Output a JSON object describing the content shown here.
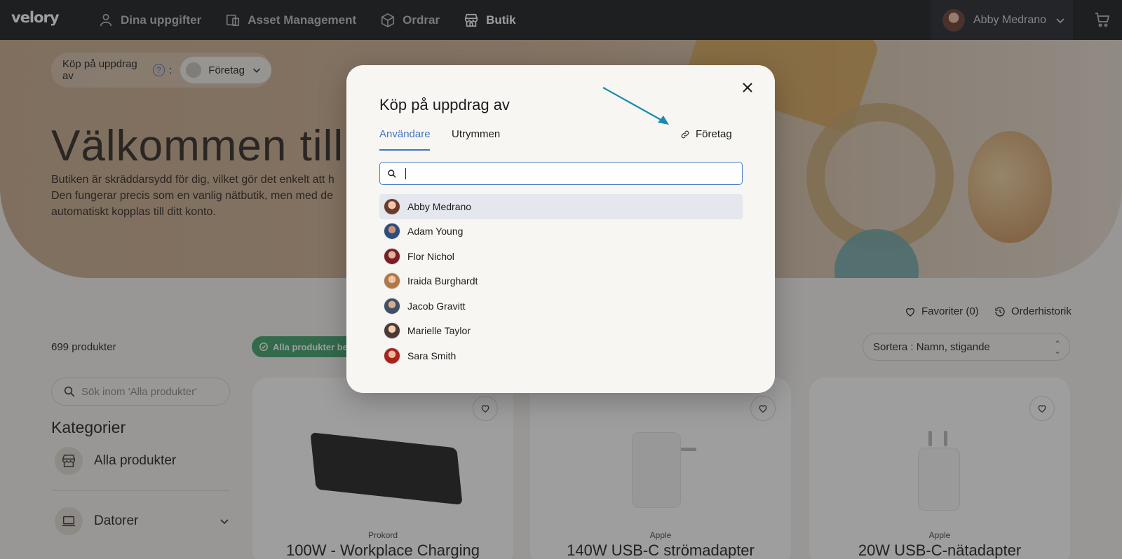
{
  "nav": {
    "logo": "velory",
    "items": [
      {
        "label": "Dina uppgifter",
        "icon": "person-icon"
      },
      {
        "label": "Asset Management",
        "icon": "assets-icon"
      },
      {
        "label": "Ordrar",
        "icon": "box-icon"
      },
      {
        "label": "Butik",
        "icon": "store-icon"
      }
    ],
    "user_name": "Abby Medrano"
  },
  "hero": {
    "on_behalf_label": "Köp på uppdrag av",
    "on_behalf_colon": ":",
    "on_behalf_value": "Företag",
    "title": "Välkommen till b",
    "desc_lines": [
      "Butiken är skräddarsydd för dig, vilket gör det enkelt att h",
      "Den fungerar precis som en vanlig nätbutik, men med de",
      "automatiskt kopplas till ditt konto."
    ]
  },
  "shop": {
    "count": "699 produkter",
    "filter_badge": "Alla produkter beta",
    "favorites": "Favoriter (0)",
    "order_history": "Orderhistorik",
    "sort": "Sortera : Namn, stigande",
    "search_placeholder": "Sök inom 'Alla produkter'",
    "categories_title": "Kategorier",
    "categories": [
      "Alla produkter",
      "Datorer"
    ],
    "products": [
      {
        "brand": "Prokord",
        "name": "100W - Workplace Charging"
      },
      {
        "brand": "Apple",
        "name": "140W USB-C strömadapter"
      },
      {
        "brand": "Apple",
        "name": "20W USB-C-nätadapter"
      }
    ]
  },
  "modal": {
    "title": "Köp på uppdrag av",
    "tabs": {
      "users": "Användare",
      "spaces": "Utrymmen",
      "company": "Företag"
    },
    "search_value": "",
    "users": [
      {
        "name": "Abby Medrano",
        "selected": true
      },
      {
        "name": "Adam Young"
      },
      {
        "name": "Flor Nichol"
      },
      {
        "name": "Iraida Burghardt"
      },
      {
        "name": "Jacob Gravitt"
      },
      {
        "name": "Marielle Taylor"
      },
      {
        "name": "Sara Smith"
      }
    ]
  },
  "colors": {
    "accent": "#3f73c4",
    "arrow": "#1a8bb0",
    "topbar": "#17181c",
    "success": "#3ca06a"
  }
}
